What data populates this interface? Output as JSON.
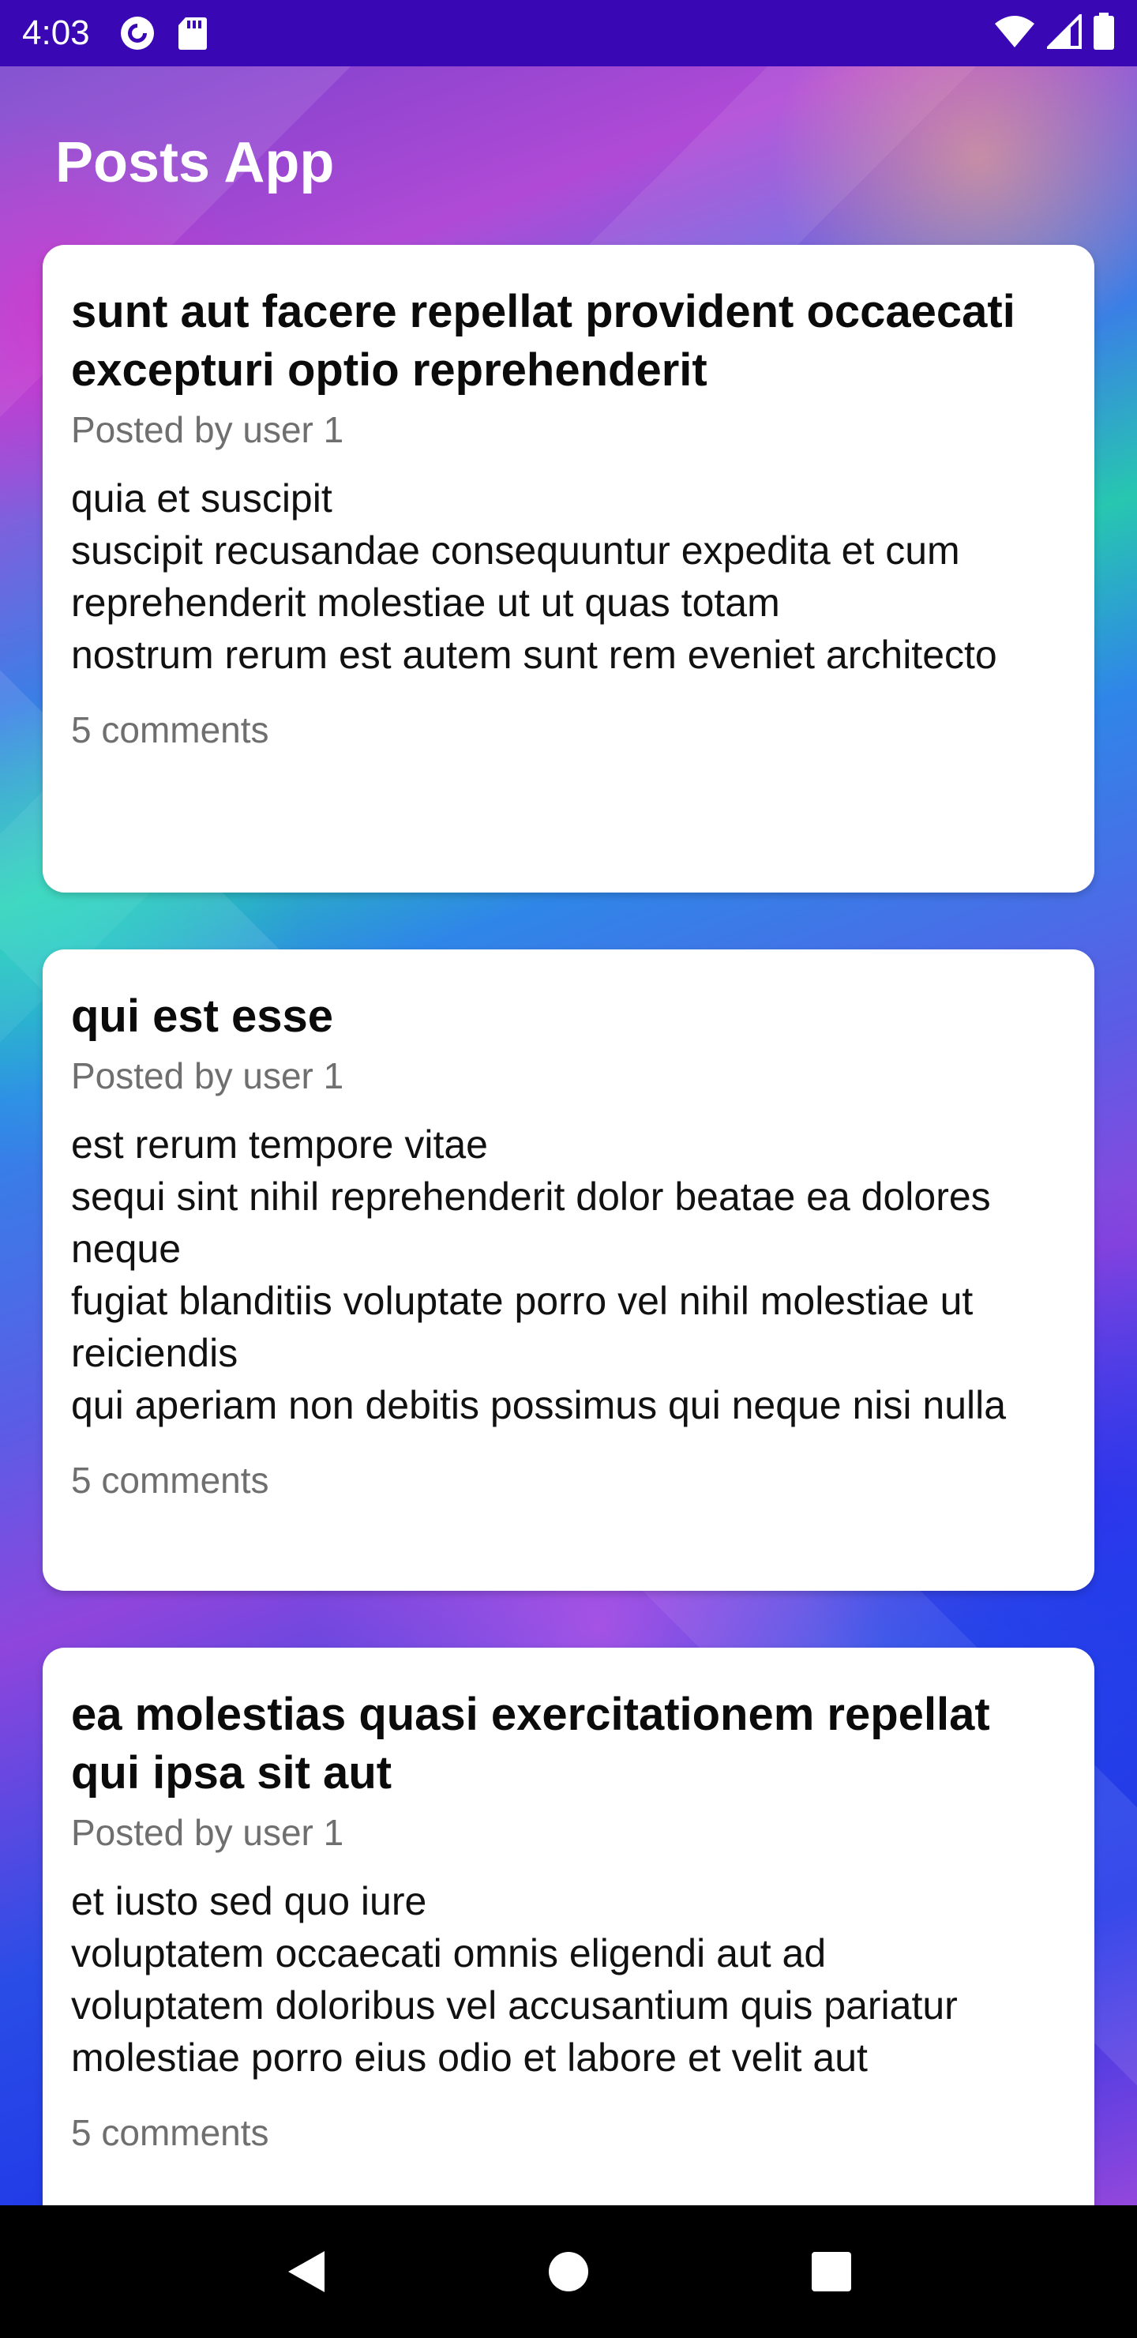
{
  "status_bar": {
    "time": "4:03",
    "left_icons": [
      "pocket-casts-icon",
      "sd-card-icon"
    ],
    "right_icons": [
      "wifi-icon",
      "cellular-signal-icon",
      "battery-icon"
    ]
  },
  "app": {
    "title": "Posts App"
  },
  "posts": [
    {
      "title": "sunt aut facere repellat provident occaecati excepturi optio reprehenderit",
      "author": "Posted by user 1",
      "body": "quia et suscipit\nsuscipit recusandae consequuntur expedita et cum\nreprehenderit molestiae ut ut quas totam\nnostrum rerum est autem sunt rem eveniet architecto",
      "comments": "5 comments"
    },
    {
      "title": "qui est esse",
      "author": "Posted by user 1",
      "body": "est rerum tempore vitae\nsequi sint nihil reprehenderit dolor beatae ea dolores neque\nfugiat blanditiis voluptate porro vel nihil molestiae ut reiciendis\nqui aperiam non debitis possimus qui neque nisi nulla",
      "comments": "5 comments"
    },
    {
      "title": "ea molestias quasi exercitationem repellat qui ipsa sit aut",
      "author": "Posted by user 1",
      "body": "et iusto sed quo iure\nvoluptatem occaecati omnis eligendi aut ad\nvoluptatem doloribus vel accusantium quis pariatur\nmolestiae porro eius odio et labore et velit aut",
      "comments": "5 comments"
    }
  ],
  "nav_bar": {
    "buttons": [
      "back-icon",
      "home-icon",
      "recents-icon"
    ]
  },
  "colors": {
    "status_bar": "#3a07b4",
    "card": "#ffffff",
    "nav_bar": "#000000"
  }
}
